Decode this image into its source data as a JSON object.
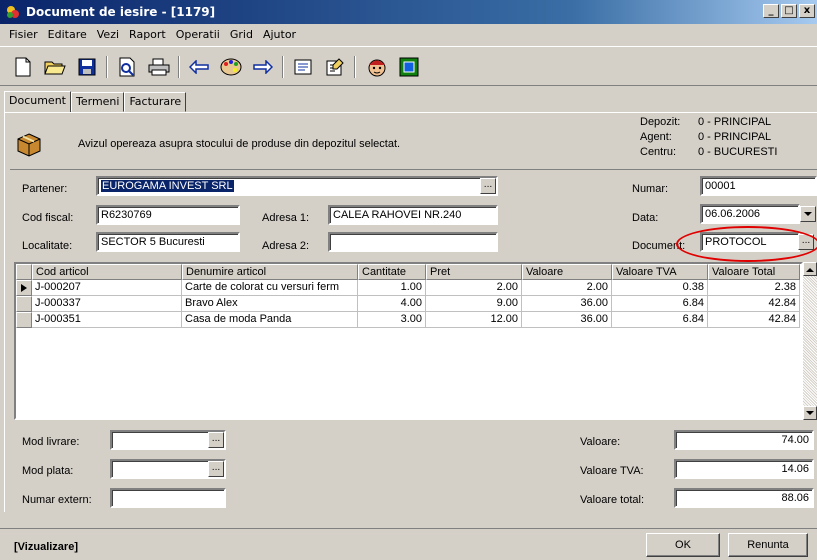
{
  "window": {
    "title": "Document de iesire - [1179]",
    "controls": [
      "_",
      "□",
      "x"
    ]
  },
  "menu": [
    "Fisier",
    "Editare",
    "Vezi",
    "Raport",
    "Operatii",
    "Grid",
    "Ajutor"
  ],
  "tabs": [
    "Document",
    "Termeni",
    "Facturare"
  ],
  "info": {
    "message": "Avizul opereaza asupra stocului de produse din depozitul selectat.",
    "depozit_label": "Depozit:",
    "depozit_value": "0 - PRINCIPAL",
    "agent_label": "Agent:",
    "agent_value": "0 - PRINCIPAL",
    "centru_label": "Centru:",
    "centru_value": "0 - BUCURESTI"
  },
  "form": {
    "partener_label": "Partener:",
    "partener_value": "EUROGAMA INVEST SRL",
    "cod_fiscal_label": "Cod fiscal:",
    "cod_fiscal_value": "R6230769",
    "adresa1_label": "Adresa 1:",
    "adresa1_value": "CALEA RAHOVEI NR.240",
    "localitate_label": "Localitate:",
    "localitate_value": "SECTOR 5 Bucuresti",
    "adresa2_label": "Adresa 2:",
    "adresa2_value": "",
    "numar_label": "Numar:",
    "numar_value": "00001",
    "data_label": "Data:",
    "data_value": "06.06.2006",
    "document_label": "Document:",
    "document_value": "PROTOCOL",
    "ellipsis": "..."
  },
  "grid": {
    "columns": [
      "Cod articol",
      "Denumire articol",
      "Cantitate",
      "Pret",
      "Valoare",
      "Valoare TVA",
      "Valoare Total"
    ],
    "rows": [
      [
        "J-000207",
        "Carte de colorat cu versuri  ferm",
        "1.00",
        "2.00",
        "2.00",
        "0.38",
        "2.38"
      ],
      [
        "J-000337",
        "Bravo Alex",
        "4.00",
        "9.00",
        "36.00",
        "6.84",
        "42.84"
      ],
      [
        "J-000351",
        "Casa de moda  Panda",
        "3.00",
        "12.00",
        "36.00",
        "6.84",
        "42.84"
      ]
    ]
  },
  "footer": {
    "mod_livrare_label": "Mod livrare:",
    "mod_plata_label": "Mod plata:",
    "numar_extern_label": "Numar extern:",
    "valoare_label": "Valoare:",
    "valoare_value": "74.00",
    "valoare_tva_label": "Valoare TVA:",
    "valoare_tva_value": "14.06",
    "valoare_total_label": "Valoare total:",
    "valoare_total_value": "88.06"
  },
  "status": {
    "mode": "[Vizualizare]",
    "ok_label": "OK",
    "renunta_label": "Renunta"
  },
  "colors": {
    "title_start": "#0a246a",
    "highlight_circle": "#e00000",
    "selection": "#0a246a"
  }
}
